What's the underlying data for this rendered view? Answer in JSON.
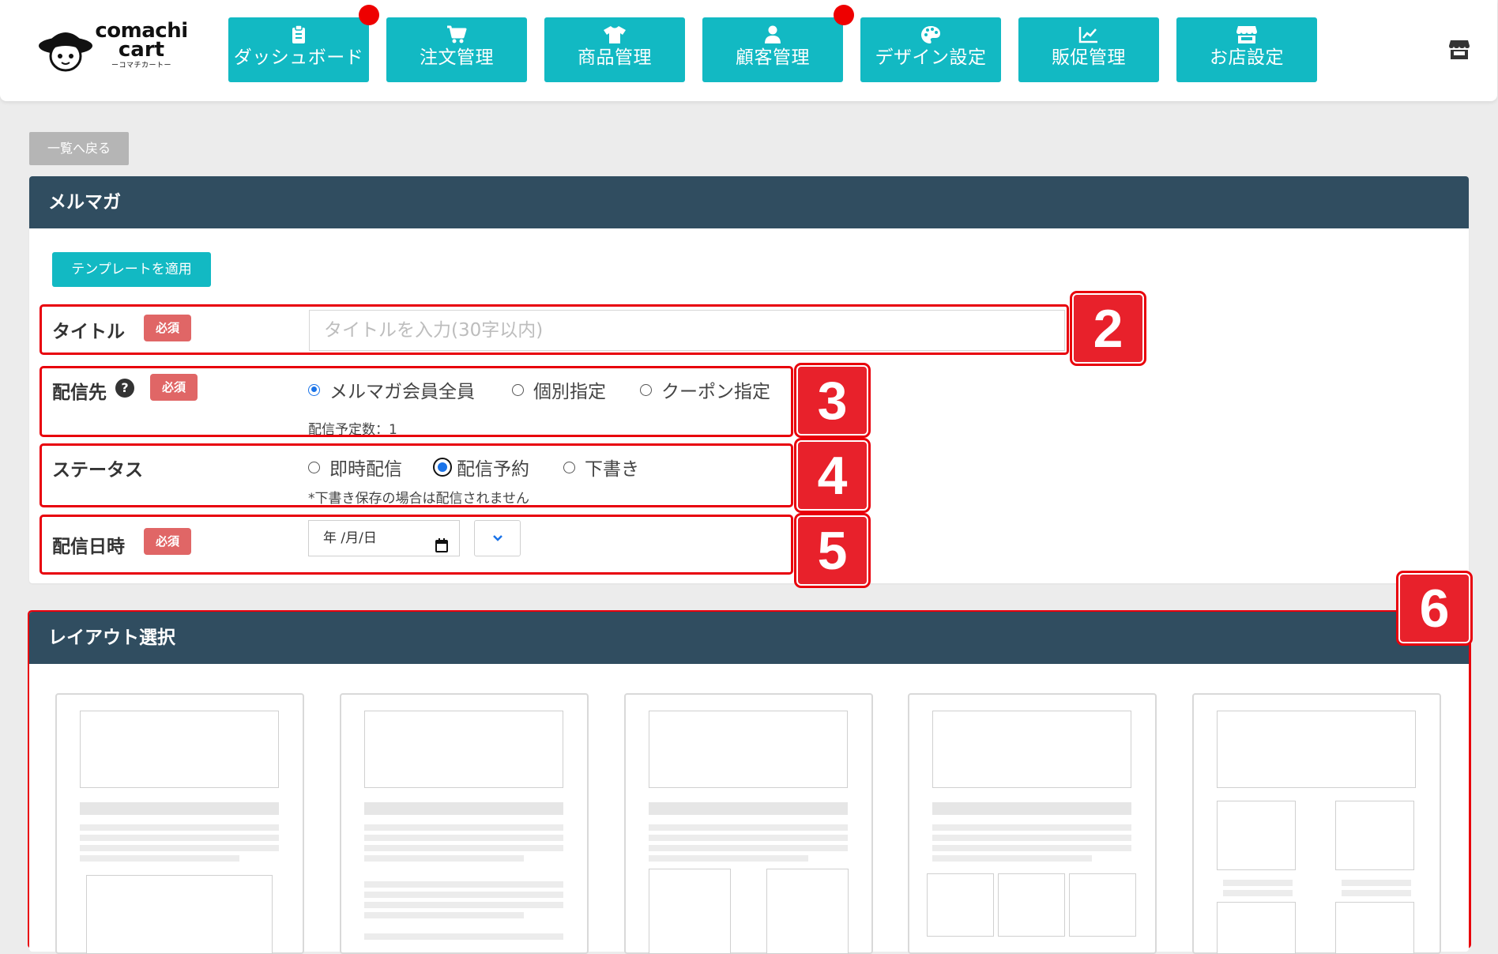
{
  "header": {
    "logo": {
      "line1": "comachi",
      "line2": "cart",
      "line3": "ーコマチカートー"
    },
    "nav": [
      {
        "label": "ダッシュボード",
        "icon": "clipboard-icon",
        "badge": true
      },
      {
        "label": "注文管理",
        "icon": "cart-icon",
        "badge": false
      },
      {
        "label": "商品管理",
        "icon": "tshirt-icon",
        "badge": false
      },
      {
        "label": "顧客管理",
        "icon": "user-icon",
        "badge": true
      },
      {
        "label": "デザイン設定",
        "icon": "palette-icon",
        "badge": false
      },
      {
        "label": "販促管理",
        "icon": "chart-line-icon",
        "badge": false
      },
      {
        "label": "お店設定",
        "icon": "store-icon",
        "badge": false
      }
    ],
    "store_icon": "store-icon"
  },
  "back_button": "一覧へ戻る",
  "newsletter": {
    "title": "メルマガ",
    "template_button": "テンプレートを適用",
    "required_label": "必須",
    "title_field": {
      "label": "タイトル",
      "placeholder": "タイトルを入力(30字以内)",
      "value": ""
    },
    "recipients": {
      "label": "配信先",
      "help": "?",
      "options": [
        "メルマガ会員全員",
        "個別指定",
        "クーポン指定"
      ],
      "selected": "メルマガ会員全員",
      "count_text": "配信予定数：1"
    },
    "status": {
      "label": "ステータス",
      "options": [
        "即時配信",
        "配信予約",
        "下書き"
      ],
      "selected": "配信予約",
      "note": "*下書き保存の場合は配信されません"
    },
    "datetime": {
      "label": "配信日時",
      "date_value": "年 /月/日"
    }
  },
  "layout_select": {
    "title": "レイアウト選択"
  },
  "annotations": [
    "2",
    "3",
    "4",
    "5",
    "6"
  ],
  "colors": {
    "teal": "#12b9c3",
    "panel_header": "#304d60",
    "required": "#e06666",
    "annotation_red": "#e8000b",
    "notify_red": "#ee0000"
  }
}
